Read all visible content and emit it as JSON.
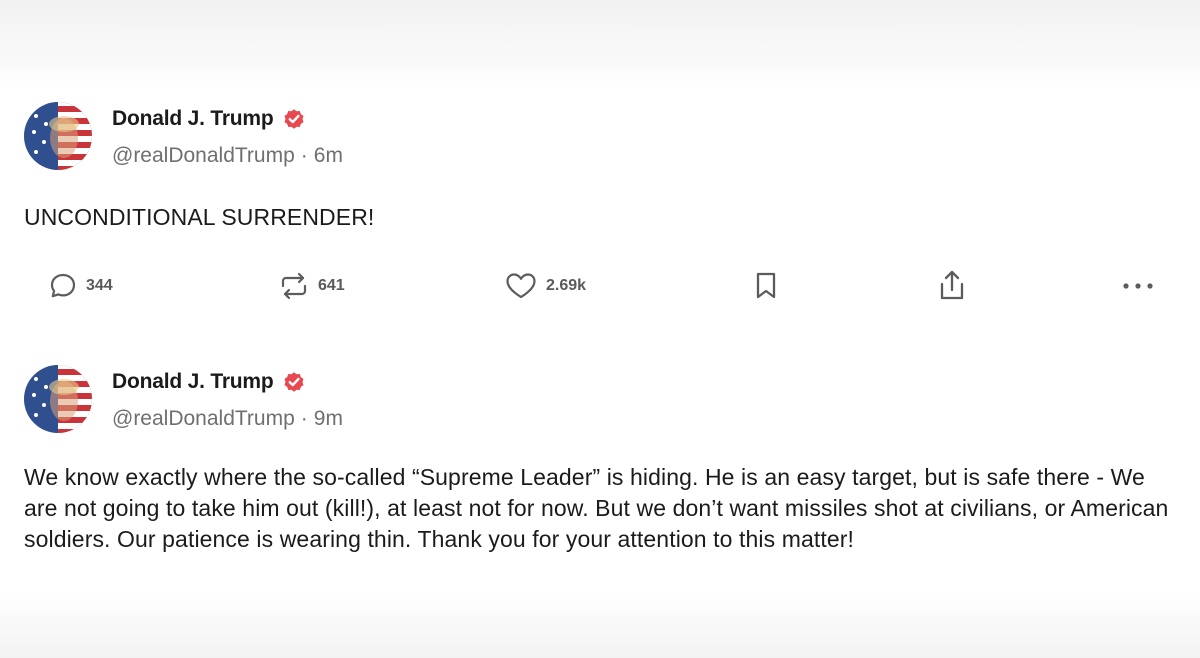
{
  "posts": [
    {
      "author": {
        "name": "Donald J. Trump",
        "handle": "@realDonaldTrump",
        "separator": "·",
        "time": "6m",
        "verified": true,
        "avatar": "flag-portrait-avatar"
      },
      "text": "UNCONDITIONAL SURRENDER!",
      "actions": {
        "replies": "344",
        "reposts": "641",
        "likes": "2.69k"
      }
    },
    {
      "author": {
        "name": "Donald J. Trump",
        "handle": "@realDonaldTrump",
        "separator": "·",
        "time": "9m",
        "verified": true,
        "avatar": "flag-portrait-avatar"
      },
      "text": "We know exactly where the so-called “Supreme Leader” is hiding. He is an easy target, but is safe there - We are not going to take him out (kill!), at least not for now. But we don’t want missiles shot at civilians, or American soldiers. Our patience is wearing thin. Thank you for your attention to this matter!"
    }
  ],
  "icons": {
    "reply": "speech-bubble-icon",
    "repost": "repost-arrows-icon",
    "like": "heart-icon",
    "bookmark": "bookmark-icon",
    "share": "share-icon",
    "more": "more-dots-icon",
    "verified": "verified-badge-icon"
  },
  "colors": {
    "verified_badge": "#e8484f",
    "text": "#1b1b1b",
    "secondary_text": "#6f6f6f",
    "icon": "#5c5c5c"
  }
}
